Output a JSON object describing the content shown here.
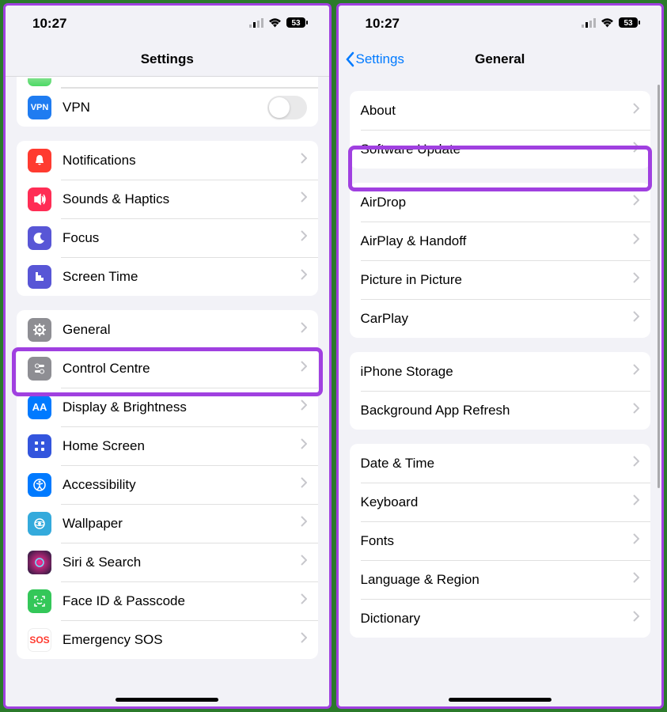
{
  "status": {
    "time": "10:27",
    "battery": "53"
  },
  "left": {
    "title": "Settings",
    "vpn": "VPN",
    "rows_g2": [
      "Notifications",
      "Sounds & Haptics",
      "Focus",
      "Screen Time"
    ],
    "rows_g3": [
      "General",
      "Control Centre",
      "Display & Brightness",
      "Home Screen",
      "Accessibility",
      "Wallpaper",
      "Siri & Search",
      "Face ID & Passcode",
      "Emergency SOS"
    ]
  },
  "right": {
    "back": "Settings",
    "title": "General",
    "g1": [
      "About",
      "Software Update"
    ],
    "g2": [
      "AirDrop",
      "AirPlay & Handoff",
      "Picture in Picture",
      "CarPlay"
    ],
    "g3": [
      "iPhone Storage",
      "Background App Refresh"
    ],
    "g4": [
      "Date & Time",
      "Keyboard",
      "Fonts",
      "Language & Region",
      "Dictionary"
    ]
  }
}
